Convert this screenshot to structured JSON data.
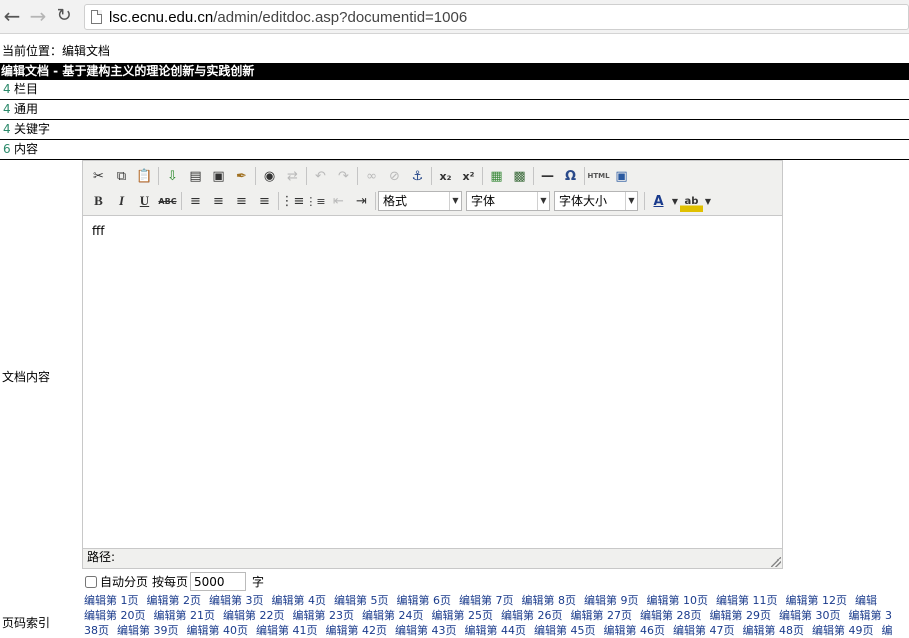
{
  "browser": {
    "url_host": "lsc.ecnu.edu.cn",
    "url_path": "/admin/editdoc.asp?documentid=1006"
  },
  "breadcrumb": "当前位置：编辑文档",
  "doc_title": "编辑文档 - 基于建构主义的理论创新与实践创新",
  "sections": [
    {
      "arrow": "4",
      "label": "栏目"
    },
    {
      "arrow": "4",
      "label": "通用"
    },
    {
      "arrow": "4",
      "label": "关键字"
    },
    {
      "arrow": "6",
      "label": "内容"
    }
  ],
  "content_label": "文档内容",
  "editor": {
    "format_select": "格式",
    "font_select": "字体",
    "size_select": "字体大小",
    "body_text": "fff",
    "path_label": "路径:"
  },
  "autopage": {
    "checkbox_label": "自动分页",
    "per_page_label": "按每页",
    "per_page_value": "5000",
    "unit": "字"
  },
  "page_index_label": "页码索引",
  "page_links": [
    [
      "编辑第 1页",
      "编辑第 2页",
      "编辑第 3页",
      "编辑第 4页",
      "编辑第 5页",
      "编辑第 6页",
      "编辑第 7页",
      "编辑第 8页",
      "编辑第 9页",
      "编辑第 10页",
      "编辑第 11页",
      "编辑第 12页",
      "编辑"
    ],
    [
      "编辑第 20页",
      "编辑第 21页",
      "编辑第 22页",
      "编辑第 23页",
      "编辑第 24页",
      "编辑第 25页",
      "编辑第 26页",
      "编辑第 27页",
      "编辑第 28页",
      "编辑第 29页",
      "编辑第 30页",
      "编辑第 3"
    ],
    [
      "38页",
      "编辑第 39页",
      "编辑第 40页",
      "编辑第 41页",
      "编辑第 42页",
      "编辑第 43页",
      "编辑第 44页",
      "编辑第 45页",
      "编辑第 46页",
      "编辑第 47页",
      "编辑第 48页",
      "编辑第 49页",
      "编"
    ]
  ]
}
